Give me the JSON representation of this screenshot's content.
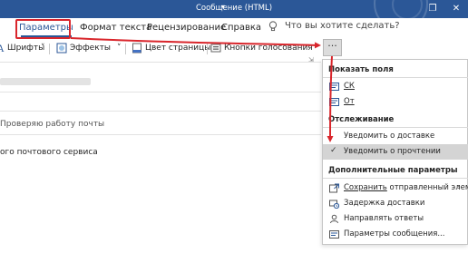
{
  "window": {
    "title": "Сообщение (HTML)",
    "title_arrow": "▾",
    "close_glyph": "✕",
    "restore_glyph": "❐"
  },
  "ribbon": {
    "tabs": [
      {
        "label": "Параметры",
        "active": true
      },
      {
        "label": "Формат текста",
        "active": false
      },
      {
        "label": "Рецензирование",
        "active": false
      },
      {
        "label": "Справка",
        "active": false
      }
    ],
    "search_placeholder": "Что вы хотите сделать?",
    "commands": {
      "fonts_label": "Шрифты",
      "fonts_caret": "˅",
      "effects_label": "Эффекты",
      "effects_caret": "˅",
      "page_color_label": "Цвет страницы",
      "page_color_caret": "˅",
      "voting_label": "Кнопки голосования"
    },
    "more_glyph": "···",
    "launcher_glyph": "⇲"
  },
  "message": {
    "info_text": "Проверяю работу почты",
    "body_text": "ого почтового сервиса"
  },
  "menu": {
    "section_show_fields": "Показать поля",
    "item_cc": "СК",
    "item_from": "От",
    "section_tracking": "Отслеживание",
    "item_delivery_receipt": "Уведомить о доставке",
    "item_read_receipt": "Уведомить о прочтении",
    "read_receipt_check": "✓",
    "section_more_options": "Дополнительные параметры",
    "item_save_sent_prefix": "Сохранить",
    "item_save_sent_rest": " отправленный элемент",
    "submenu_arrow": "›",
    "item_delay_delivery": "Задержка доставки",
    "item_direct_replies": "Направлять ответы",
    "item_message_options": "Параметры сообщения..."
  },
  "colors": {
    "titlebar": "#2b5797",
    "accent": "#2b5797",
    "annotation_red": "#d9262c",
    "menu_highlight": "#d4d4d4"
  },
  "icons": [
    "lightbulb-icon",
    "fonts-icon",
    "effects-icon",
    "page-color-icon",
    "voting-buttons-icon",
    "cc-icon",
    "from-icon",
    "save-sent-icon",
    "delay-delivery-icon",
    "direct-replies-icon",
    "message-options-icon",
    "checkmark-icon"
  ]
}
